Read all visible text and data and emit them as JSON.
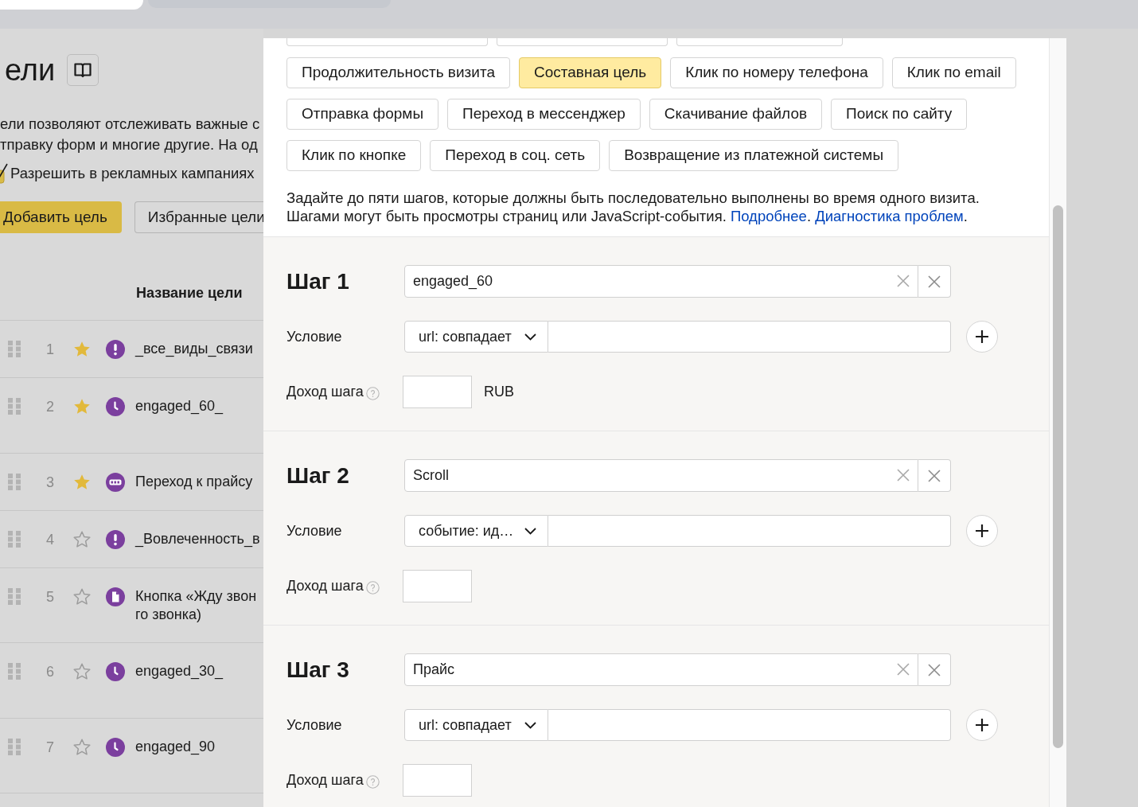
{
  "goals_page": {
    "title": "ели",
    "description_lines": [
      "ели позволяют отслеживать важные с",
      "тправку форм и многие другие. На од"
    ],
    "ads_checkbox": {
      "label": "Разрешить в рекламных кампаниях",
      "checked": true
    },
    "buttons": [
      {
        "label": "Добавить цель",
        "kind": "primary"
      },
      {
        "label": "Избранные цели",
        "kind": "secondary"
      }
    ],
    "table": {
      "columns": [
        "Название цели"
      ],
      "rows": [
        {
          "number": "1",
          "favorite": true,
          "kind": "event",
          "name": "_все_виды_связи"
        },
        {
          "number": "2",
          "favorite": true,
          "kind": "time",
          "name": "engaged_60_"
        },
        {
          "number": "3",
          "favorite": true,
          "kind": "url",
          "name": "Переход к прайсу"
        },
        {
          "number": "4",
          "favorite": false,
          "kind": "event",
          "name": "_Вовлеченность_в"
        },
        {
          "number": "5",
          "favorite": false,
          "kind": "page",
          "name": "Кнопка «Жду звон\nго звонка)"
        },
        {
          "number": "6",
          "favorite": false,
          "kind": "time",
          "name": "engaged_30_"
        },
        {
          "number": "7",
          "favorite": false,
          "kind": "time",
          "name": "engaged_90"
        }
      ]
    }
  },
  "dialog": {
    "goal_types": [
      [
        {
          "label": "Продолжительность визита",
          "selected": false
        },
        {
          "label": "Составная цель",
          "selected": true
        },
        {
          "label": "Клик по номеру телефона",
          "selected": false
        },
        {
          "label": "Клик по email",
          "selected": false
        }
      ],
      [
        {
          "label": "Отправка формы",
          "selected": false
        },
        {
          "label": "Переход в мессенджер",
          "selected": false
        },
        {
          "label": "Скачивание файлов",
          "selected": false
        },
        {
          "label": "Поиск по сайту",
          "selected": false
        }
      ],
      [
        {
          "label": "Клик по кнопке",
          "selected": false
        },
        {
          "label": "Переход в соц. сеть",
          "selected": false
        },
        {
          "label": "Возвращение из платежной системы",
          "selected": false
        }
      ]
    ],
    "description": {
      "lines": [
        "Задайте до пяти шагов, которые должны быть последовательно выполнены во время одного визита.",
        "Шагами могут быть просмотры страниц или JavaScript-события."
      ],
      "links": [
        {
          "label": "Подробнее",
          "after": "."
        },
        {
          "label": "Диагностика проблем",
          "after": "."
        }
      ]
    },
    "steps": [
      {
        "title": "Шаг 1",
        "name": "engaged_60",
        "condition_label": "Условие",
        "condition": "url: совпадает",
        "revenue_label": "Доход шага",
        "currency": "RUB"
      },
      {
        "title": "Шаг 2",
        "name": "Scroll",
        "condition_label": "Условие",
        "condition": "событие: ид…",
        "revenue_label": "Доход шага"
      },
      {
        "title": "Шаг 3",
        "name": "Прайс",
        "condition_label": "Условие",
        "condition": "url: совпадает",
        "revenue_label": "Доход шага"
      }
    ]
  }
}
